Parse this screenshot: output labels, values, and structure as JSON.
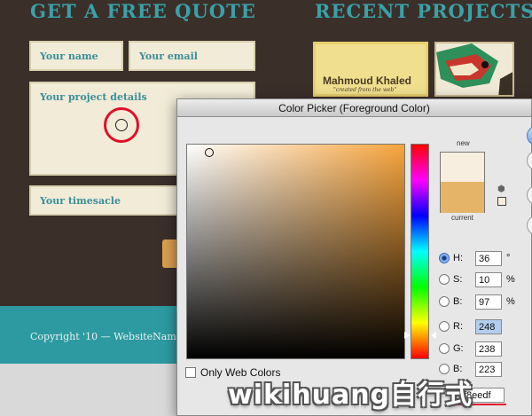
{
  "website": {
    "quote_heading": "GET A FREE QUOTE",
    "projects_heading": "RECENT PROJECTS",
    "fields": {
      "name_placeholder": "Your name",
      "email_placeholder": "Your email",
      "details_placeholder": "Your project details",
      "timescale_placeholder": "Your timesacle"
    },
    "copyright": "Copyright '10 — WebsiteNam",
    "project1": {
      "title": "Mahmoud Khaled",
      "subtitle": "\"created from the web\""
    }
  },
  "color_picker": {
    "title": "Color Picker (Foreground Color)",
    "new_label": "new",
    "current_label": "current",
    "new_color": "#f8eedf",
    "current_color": "#e6b469",
    "hue_label": "H:",
    "hue_value": "36",
    "hue_unit": "°",
    "sat_label": "S:",
    "sat_value": "10",
    "sat_unit": "%",
    "bri_label": "B:",
    "bri_value": "97",
    "bri_unit": "%",
    "r_label": "R:",
    "r_value": "248",
    "g_label": "G:",
    "g_value": "238",
    "b_label": "B:",
    "b_value": "223",
    "hex_label": "#",
    "hex_value": "f8eedf",
    "only_web_colors": "Only Web Colors",
    "selected_mode": "H"
  },
  "watermark": "wikihuang自行式"
}
